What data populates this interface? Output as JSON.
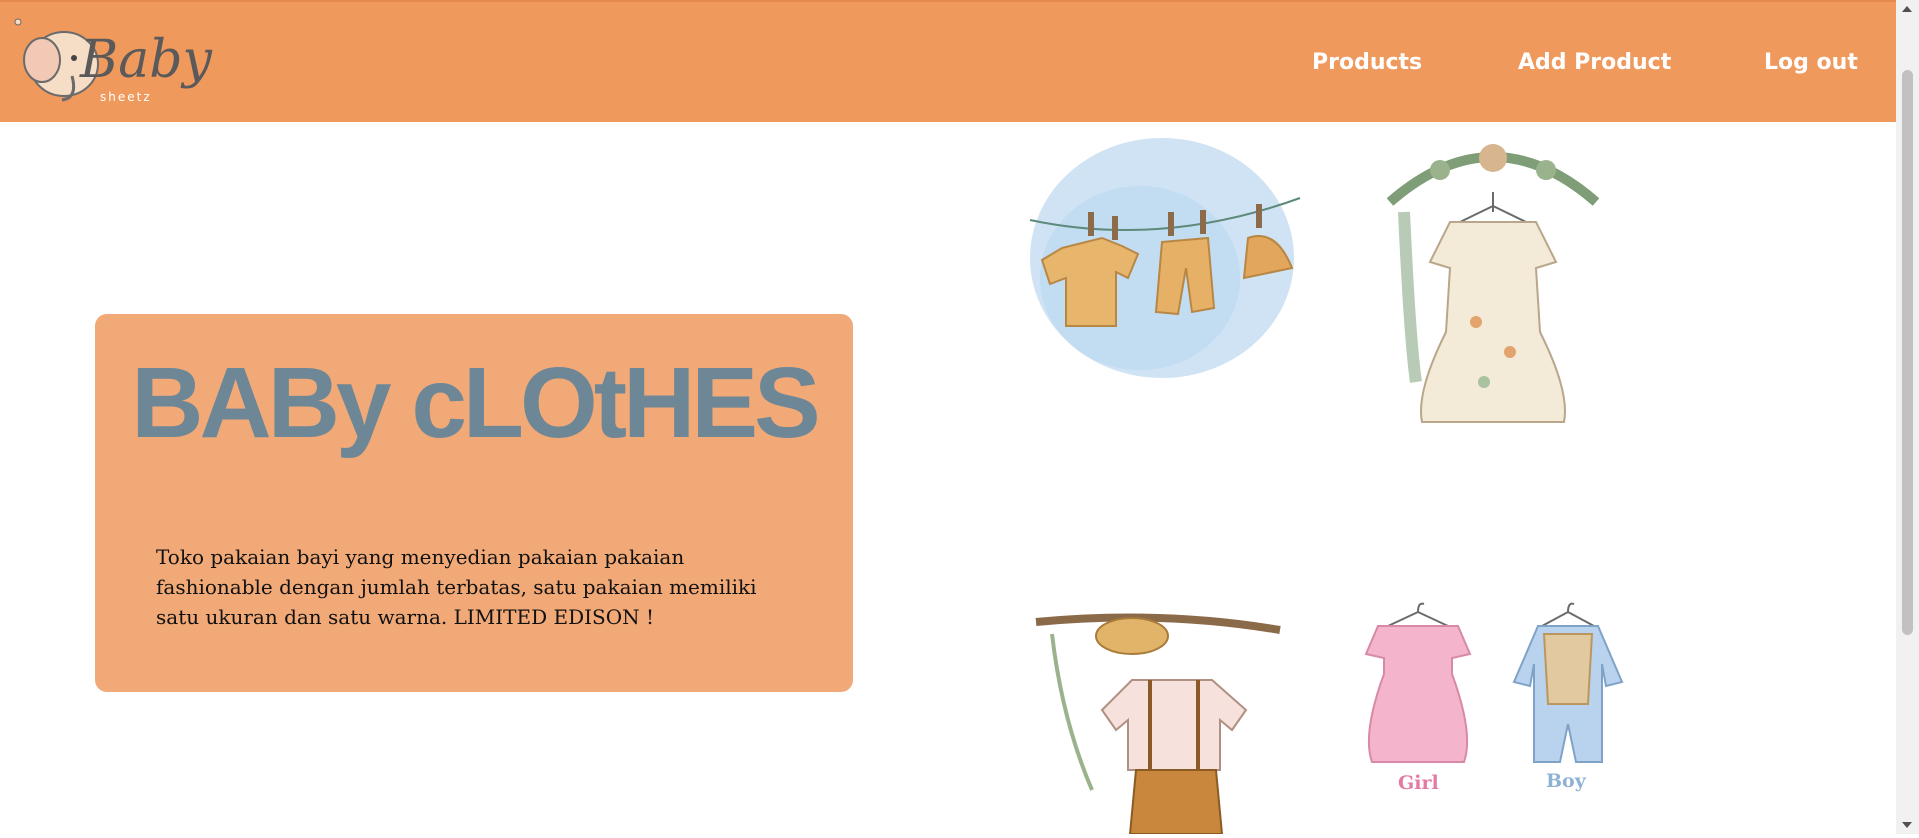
{
  "brand": {
    "logo_text": "Baby",
    "logo_sub": "sheetz"
  },
  "nav": {
    "products": "Products",
    "add_product": "Add Product",
    "logout": "Log out"
  },
  "hero": {
    "title": "BABy cLOtHES",
    "description": "Toko pakaian bayi yang menyedian pakaian pakaian fashionable dengan jumlah terbatas, satu pakaian memiliki satu ukuran dan satu warna. LIMITED EDISON !"
  },
  "gallery": {
    "tile4": {
      "girl_label": "Girl",
      "boy_label": "Boy"
    }
  },
  "colors": {
    "navbar": "#f0995d",
    "hero_card": "#f0a977",
    "hero_title": "#6e8797"
  }
}
